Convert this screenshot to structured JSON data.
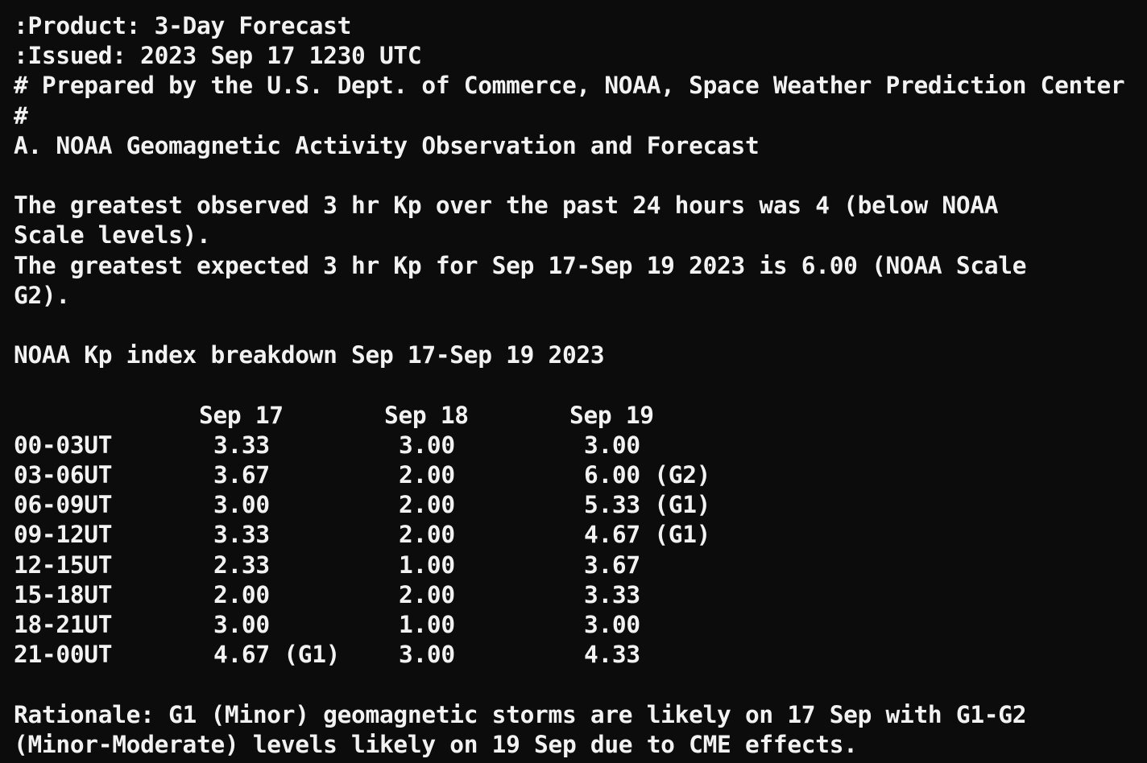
{
  "header": {
    "product": ":Product: 3-Day Forecast",
    "issued": ":Issued: 2023 Sep 17 1230 UTC",
    "prepared": "# Prepared by the U.S. Dept. of Commerce, NOAA, Space Weather Prediction Center",
    "hash": "#"
  },
  "section_a": {
    "title": "A. NOAA Geomagnetic Activity Observation and Forecast",
    "observed_line1": "The greatest observed 3 hr Kp over the past 24 hours was 4 (below NOAA",
    "observed_line2": "Scale levels).",
    "expected_line1": "The greatest expected 3 hr Kp for Sep 17-Sep 19 2023 is 6.00 (NOAA Scale",
    "expected_line2": "G2).",
    "breakdown_title": "NOAA Kp index breakdown Sep 17-Sep 19 2023"
  },
  "kp_table": {
    "headers": [
      "Sep 17",
      "Sep 18",
      "Sep 19"
    ],
    "rows": [
      {
        "period": "00-03UT",
        "d1": "3.33",
        "d2": "3.00",
        "d3": "3.00"
      },
      {
        "period": "03-06UT",
        "d1": "3.67",
        "d2": "2.00",
        "d3": "6.00 (G2)"
      },
      {
        "period": "06-09UT",
        "d1": "3.00",
        "d2": "2.00",
        "d3": "5.33 (G1)"
      },
      {
        "period": "09-12UT",
        "d1": "3.33",
        "d2": "2.00",
        "d3": "4.67 (G1)"
      },
      {
        "period": "12-15UT",
        "d1": "2.33",
        "d2": "1.00",
        "d3": "3.67"
      },
      {
        "period": "15-18UT",
        "d1": "2.00",
        "d2": "2.00",
        "d3": "3.33"
      },
      {
        "period": "18-21UT",
        "d1": "3.00",
        "d2": "1.00",
        "d3": "3.00"
      },
      {
        "period": "21-00UT",
        "d1": "4.67 (G1)",
        "d2": "3.00",
        "d3": "4.33"
      }
    ]
  },
  "rationale": {
    "line1": "Rationale: G1 (Minor) geomagnetic storms are likely on 17 Sep with G1-G2",
    "line2": "(Minor-Moderate) levels likely on 19 Sep due to CME effects."
  }
}
